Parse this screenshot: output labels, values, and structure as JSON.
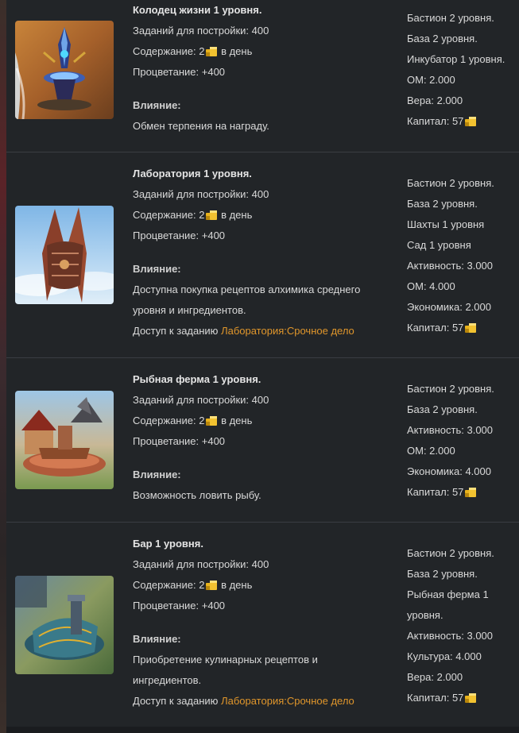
{
  "colors": {
    "background": "#222528",
    "text": "#d9d9d9",
    "link": "#e0962b",
    "divider": "#3a3d42",
    "coin": "#e8b21c"
  },
  "buildings": [
    {
      "title": "Колодец жизни 1 уровня.",
      "tasks": "Заданий для постройки: 400",
      "upkeep_prefix": "Содержание: 2",
      "upkeep_suffix": "в день",
      "prosperity": "Процветание: +400",
      "influence_label": "Влияние:",
      "influence": "Обмен терпения на награду.",
      "requirements": [
        "Бастион 2 уровня.",
        "База 2 уровня.",
        "Инкубатор 1 уровня.",
        "ОМ: 2.000",
        "Вера: 2.000",
        "Капитал: 57"
      ],
      "image_icon": "well-of-life-icon"
    },
    {
      "title": "Лаборатория 1 уровня.",
      "tasks": "Заданий для постройки: 400",
      "upkeep_prefix": "Содержание: 2",
      "upkeep_suffix": "в день",
      "prosperity": "Процветание: +400",
      "influence_label": "Влияние:",
      "influence": "Доступна покупка рецептов алхимика среднего уровня и ингредиентов.",
      "quest_prefix": "Доступ к заданию",
      "quest_link": "Лаборатория:Срочное дело",
      "requirements": [
        "Бастион 2 уровня.",
        "База 2 уровня.",
        "Шахты 1 уровня",
        "Сад 1 уровня",
        "Активность: 3.000",
        "ОМ: 4.000",
        "Экономика: 2.000",
        "Капитал: 57"
      ],
      "image_icon": "laboratory-icon"
    },
    {
      "title": "Рыбная ферма 1 уровня.",
      "tasks": "Заданий для постройки: 400",
      "upkeep_prefix": "Содержание: 2",
      "upkeep_suffix": "в день",
      "prosperity": "Процветание: +400",
      "influence_label": "Влияние:",
      "influence": "Возможность ловить рыбу.",
      "requirements": [
        "Бастион 2 уровня.",
        "База 2 уровня.",
        "Активность: 3.000",
        "ОМ: 2.000",
        "Экономика: 4.000",
        "Капитал: 57"
      ],
      "image_icon": "fish-farm-icon"
    },
    {
      "title": "Бар 1 уровня.",
      "tasks": "Заданий для постройки: 400",
      "upkeep_prefix": "Содержание: 2",
      "upkeep_suffix": "в день",
      "prosperity": "Процветание: +400",
      "influence_label": "Влияние:",
      "influence": "Приобретение кулинарных рецептов и ингредиентов.",
      "quest_prefix": "Доступ к заданию",
      "quest_link": "Лаборатория:Срочное дело",
      "requirements": [
        "Бастион 2 уровня.",
        "База 2 уровня.",
        "Рыбная ферма 1 уровня.",
        "Активность: 3.000",
        "Культура: 4.000",
        "Вера: 2.000",
        "Капитал: 57"
      ],
      "image_icon": "bar-icon"
    }
  ]
}
